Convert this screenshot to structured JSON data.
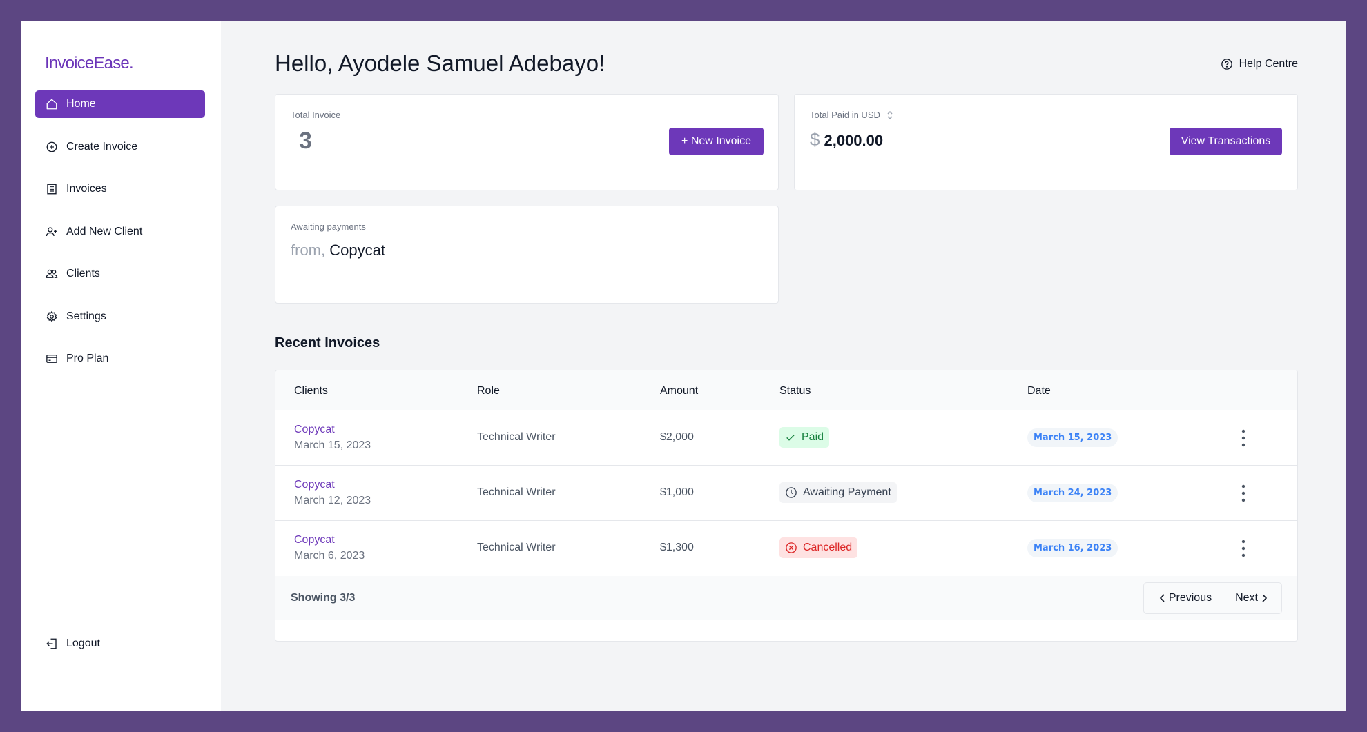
{
  "app": {
    "logo": "InvoiceEase."
  },
  "sidebar": {
    "items": [
      {
        "label": "Home",
        "icon": "home-icon",
        "active": true
      },
      {
        "label": "Create Invoice",
        "icon": "plus-circle-icon"
      },
      {
        "label": "Invoices",
        "icon": "invoice-icon"
      },
      {
        "label": "Add New Client",
        "icon": "user-plus-icon"
      },
      {
        "label": "Clients",
        "icon": "users-icon"
      },
      {
        "label": "Settings",
        "icon": "gear-icon"
      },
      {
        "label": "Pro Plan",
        "icon": "credit-card-icon"
      }
    ],
    "logout": "Logout"
  },
  "header": {
    "greeting": "Hello, Ayodele Samuel Adebayo!",
    "help": "Help Centre"
  },
  "cards": {
    "total_invoice": {
      "label": "Total Invoice",
      "value": "3",
      "button": "+ New Invoice"
    },
    "total_paid": {
      "label": "Total Paid in USD",
      "currency": "$",
      "value": "2,000.00",
      "button": "View Transactions"
    },
    "awaiting": {
      "label": "Awaiting payments",
      "from": "from,",
      "client": "Copycat"
    }
  },
  "recent": {
    "title": "Recent Invoices",
    "columns": [
      "Clients",
      "Role",
      "Amount",
      "Status",
      "Date"
    ],
    "rows": [
      {
        "client": "Copycat",
        "client_date": "March 15, 2023",
        "role": "Technical Writer",
        "amount": "$2,000",
        "status": "Paid",
        "status_type": "paid",
        "date": "March 15, 2023"
      },
      {
        "client": "Copycat",
        "client_date": "March 12, 2023",
        "role": "Technical Writer",
        "amount": "$1,000",
        "status": "Awaiting Payment",
        "status_type": "await",
        "date": "March 24, 2023"
      },
      {
        "client": "Copycat",
        "client_date": "March 6, 2023",
        "role": "Technical Writer",
        "amount": "$1,300",
        "status": "Cancelled",
        "status_type": "cancel",
        "date": "March 16, 2023"
      }
    ],
    "footer": {
      "showing": "Showing 3/3",
      "previous": "Previous",
      "next": "Next"
    }
  },
  "colors": {
    "accent": "#6d38b9",
    "background": "#5c4682",
    "paid": "#15803d",
    "cancelled": "#dc2626",
    "date_pill": "#3b82f6"
  }
}
